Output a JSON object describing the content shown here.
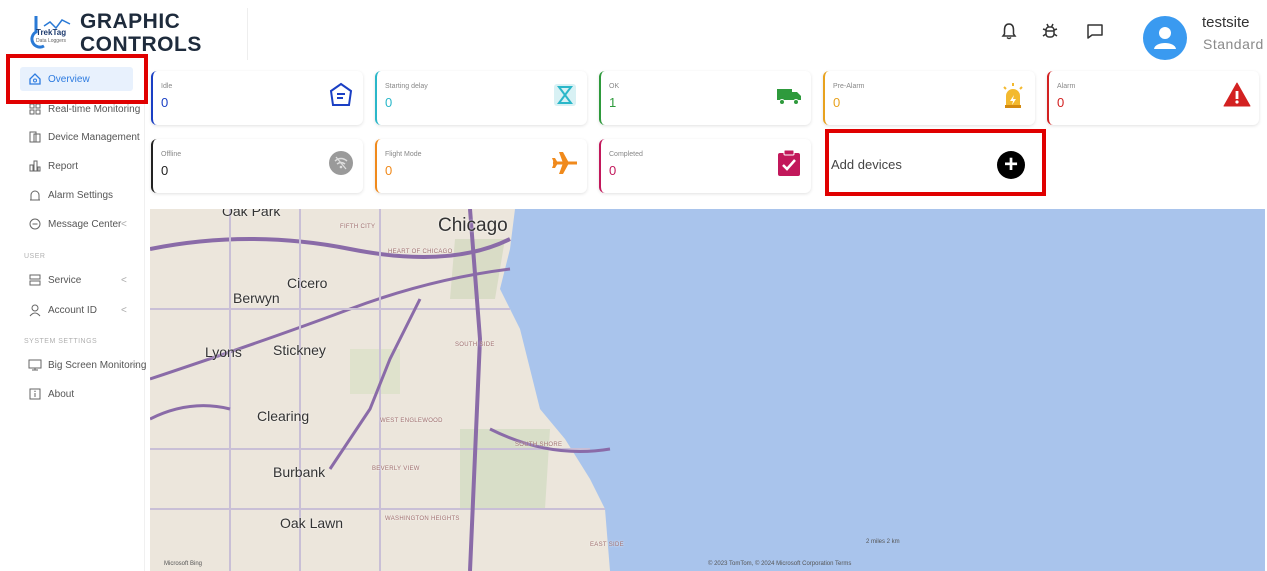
{
  "header": {
    "logo_badge": "TrekTag",
    "logo_badge_sub": "Data Loggers",
    "brand_line1": "GRAPHIC",
    "brand_line2": "CONTROLS",
    "user_name": "testsite",
    "user_role": "Standard",
    "icons": [
      "bell-icon",
      "bug-icon",
      "message-icon",
      "user-avatar-icon"
    ]
  },
  "sidebar": {
    "items": [
      {
        "label": "Overview",
        "icon": "home-icon",
        "active": true
      },
      {
        "label": "Real-time Monitoring",
        "icon": "grid-icon"
      },
      {
        "label": "Device Management",
        "icon": "device-icon"
      },
      {
        "label": "Report",
        "icon": "chart-icon"
      },
      {
        "label": "Alarm Settings",
        "icon": "alarm-icon"
      },
      {
        "label": "Message Center",
        "icon": "message-icon",
        "chevron": "<"
      }
    ],
    "section_user": "USER",
    "user_items": [
      {
        "label": "Service",
        "icon": "server-icon",
        "chevron": "<"
      },
      {
        "label": "Account ID",
        "icon": "person-icon",
        "chevron": "<"
      }
    ],
    "section_system": "SYSTEM SETTINGS",
    "system_items": [
      {
        "label": "Big Screen Monitoring",
        "icon": "monitor-icon",
        "chevron": "<"
      },
      {
        "label": "About",
        "icon": "info-icon"
      }
    ]
  },
  "status_cards": [
    {
      "label": "Idle",
      "value": "0",
      "color": "#1a3fc4",
      "icon": "box-icon"
    },
    {
      "label": "Starting delay",
      "value": "0",
      "color": "#2ab7c9",
      "icon": "hourglass-icon"
    },
    {
      "label": "OK",
      "value": "1",
      "color": "#2e9a3c",
      "icon": "truck-icon"
    },
    {
      "label": "Pre-Alarm",
      "value": "0",
      "color": "#e8a21e",
      "icon": "siren-icon"
    },
    {
      "label": "Alarm",
      "value": "0",
      "color": "#d32121",
      "icon": "warning-icon"
    },
    {
      "label": "Offline",
      "value": "0",
      "color": "#222222",
      "icon": "wifi-off-icon"
    },
    {
      "label": "Flight Mode",
      "value": "0",
      "color": "#f08a1c",
      "icon": "airplane-icon"
    },
    {
      "label": "Completed",
      "value": "0",
      "color": "#c2185b",
      "icon": "clipboard-check-icon"
    }
  ],
  "add_devices": {
    "label": "Add devices",
    "icon": "plus-circle-icon"
  },
  "map": {
    "places": [
      "Oak Park",
      "Chicago",
      "Cicero",
      "Berwyn",
      "Lyons",
      "Stickney",
      "Clearing",
      "Burbank",
      "Oak Lawn"
    ],
    "small_places": [
      "FIFTH CITY",
      "HEART OF CHICAGO",
      "SOUTH SIDE",
      "WEST ENGLEWOOD",
      "SOUTH SHORE",
      "BEVERLY VIEW",
      "WASHINGTON HEIGHTS",
      "EAST SIDE"
    ],
    "scale": "2 miles     2 km",
    "attribution": "© 2023 TomTom, © 2024 Microsoft Corporation  Terms",
    "provider": "Microsoft Bing"
  }
}
